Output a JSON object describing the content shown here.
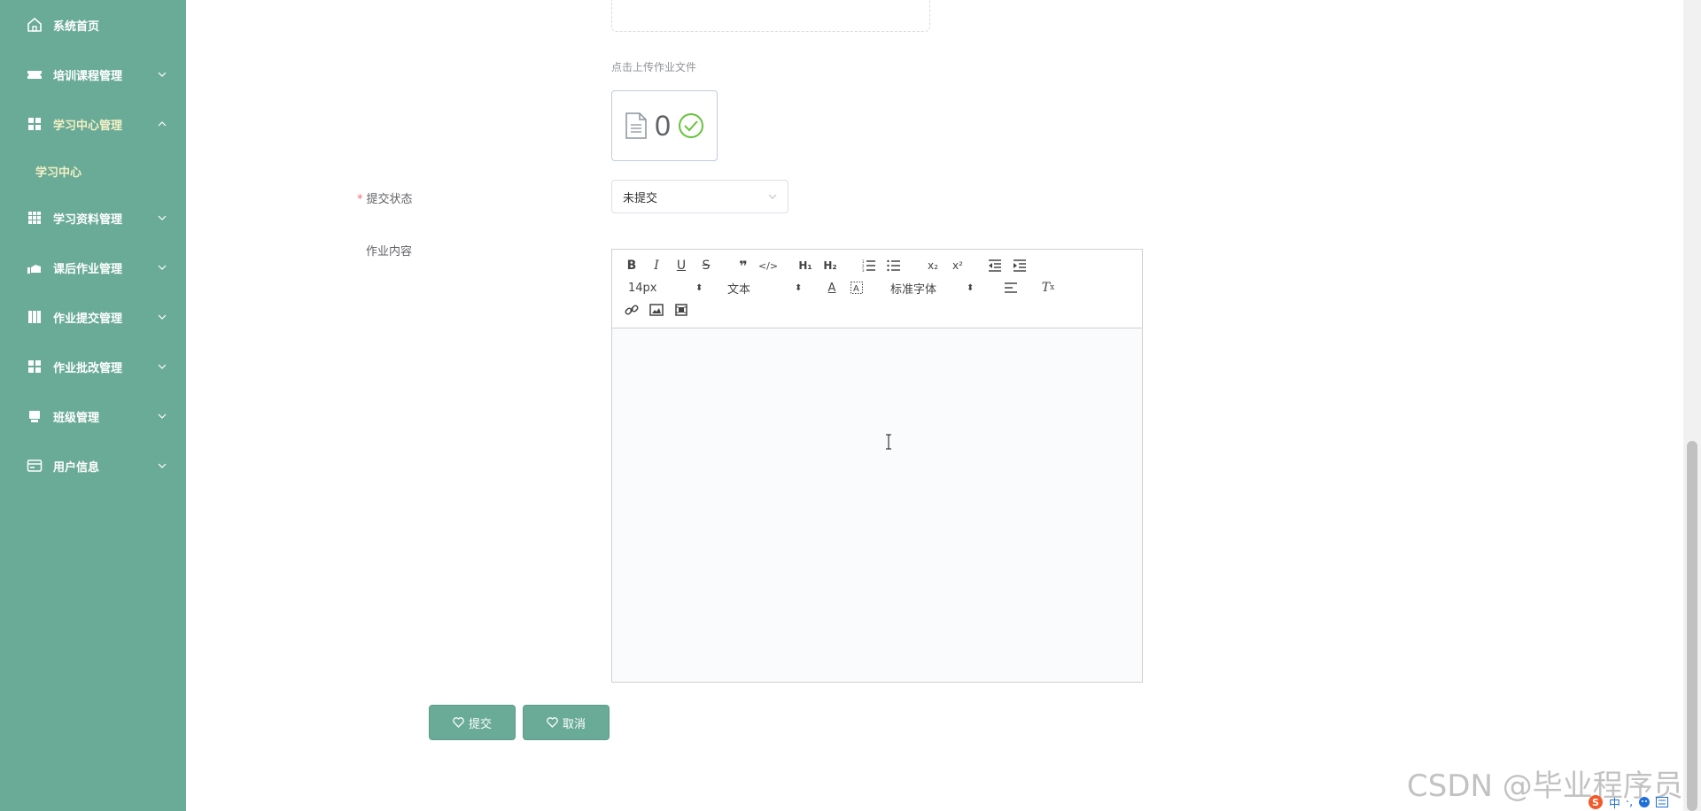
{
  "sidebar": {
    "items": [
      {
        "label": "系统首页",
        "icon": "home-icon"
      },
      {
        "label": "培训课程管理",
        "icon": "ticket-icon"
      },
      {
        "label": "学习中心管理",
        "icon": "grid-icon"
      },
      {
        "label": "学习中心",
        "icon": ""
      },
      {
        "label": "学习资料管理",
        "icon": "table-icon"
      },
      {
        "label": "课后作业管理",
        "icon": "hand-icon"
      },
      {
        "label": "作业提交管理",
        "icon": "columns-icon"
      },
      {
        "label": "作业批改管理",
        "icon": "grid-icon"
      },
      {
        "label": "班级管理",
        "icon": "monitor-icon"
      },
      {
        "label": "用户信息",
        "icon": "card-icon"
      }
    ],
    "bg_color": "#6aab97",
    "active_text_color": "#f4f0c6"
  },
  "form": {
    "upload_hint": "点击上传作业文件",
    "file_count": "0",
    "status_label": "提交状态",
    "status_value": "未提交",
    "content_label": "作业内容"
  },
  "editor": {
    "size_picker": "14px",
    "header_picker": "文本",
    "font_picker": "标准字体"
  },
  "buttons": {
    "submit": "提交",
    "cancel": "取消"
  },
  "watermark": "CSDN @毕业程序员",
  "tray": {
    "ime": "中"
  }
}
